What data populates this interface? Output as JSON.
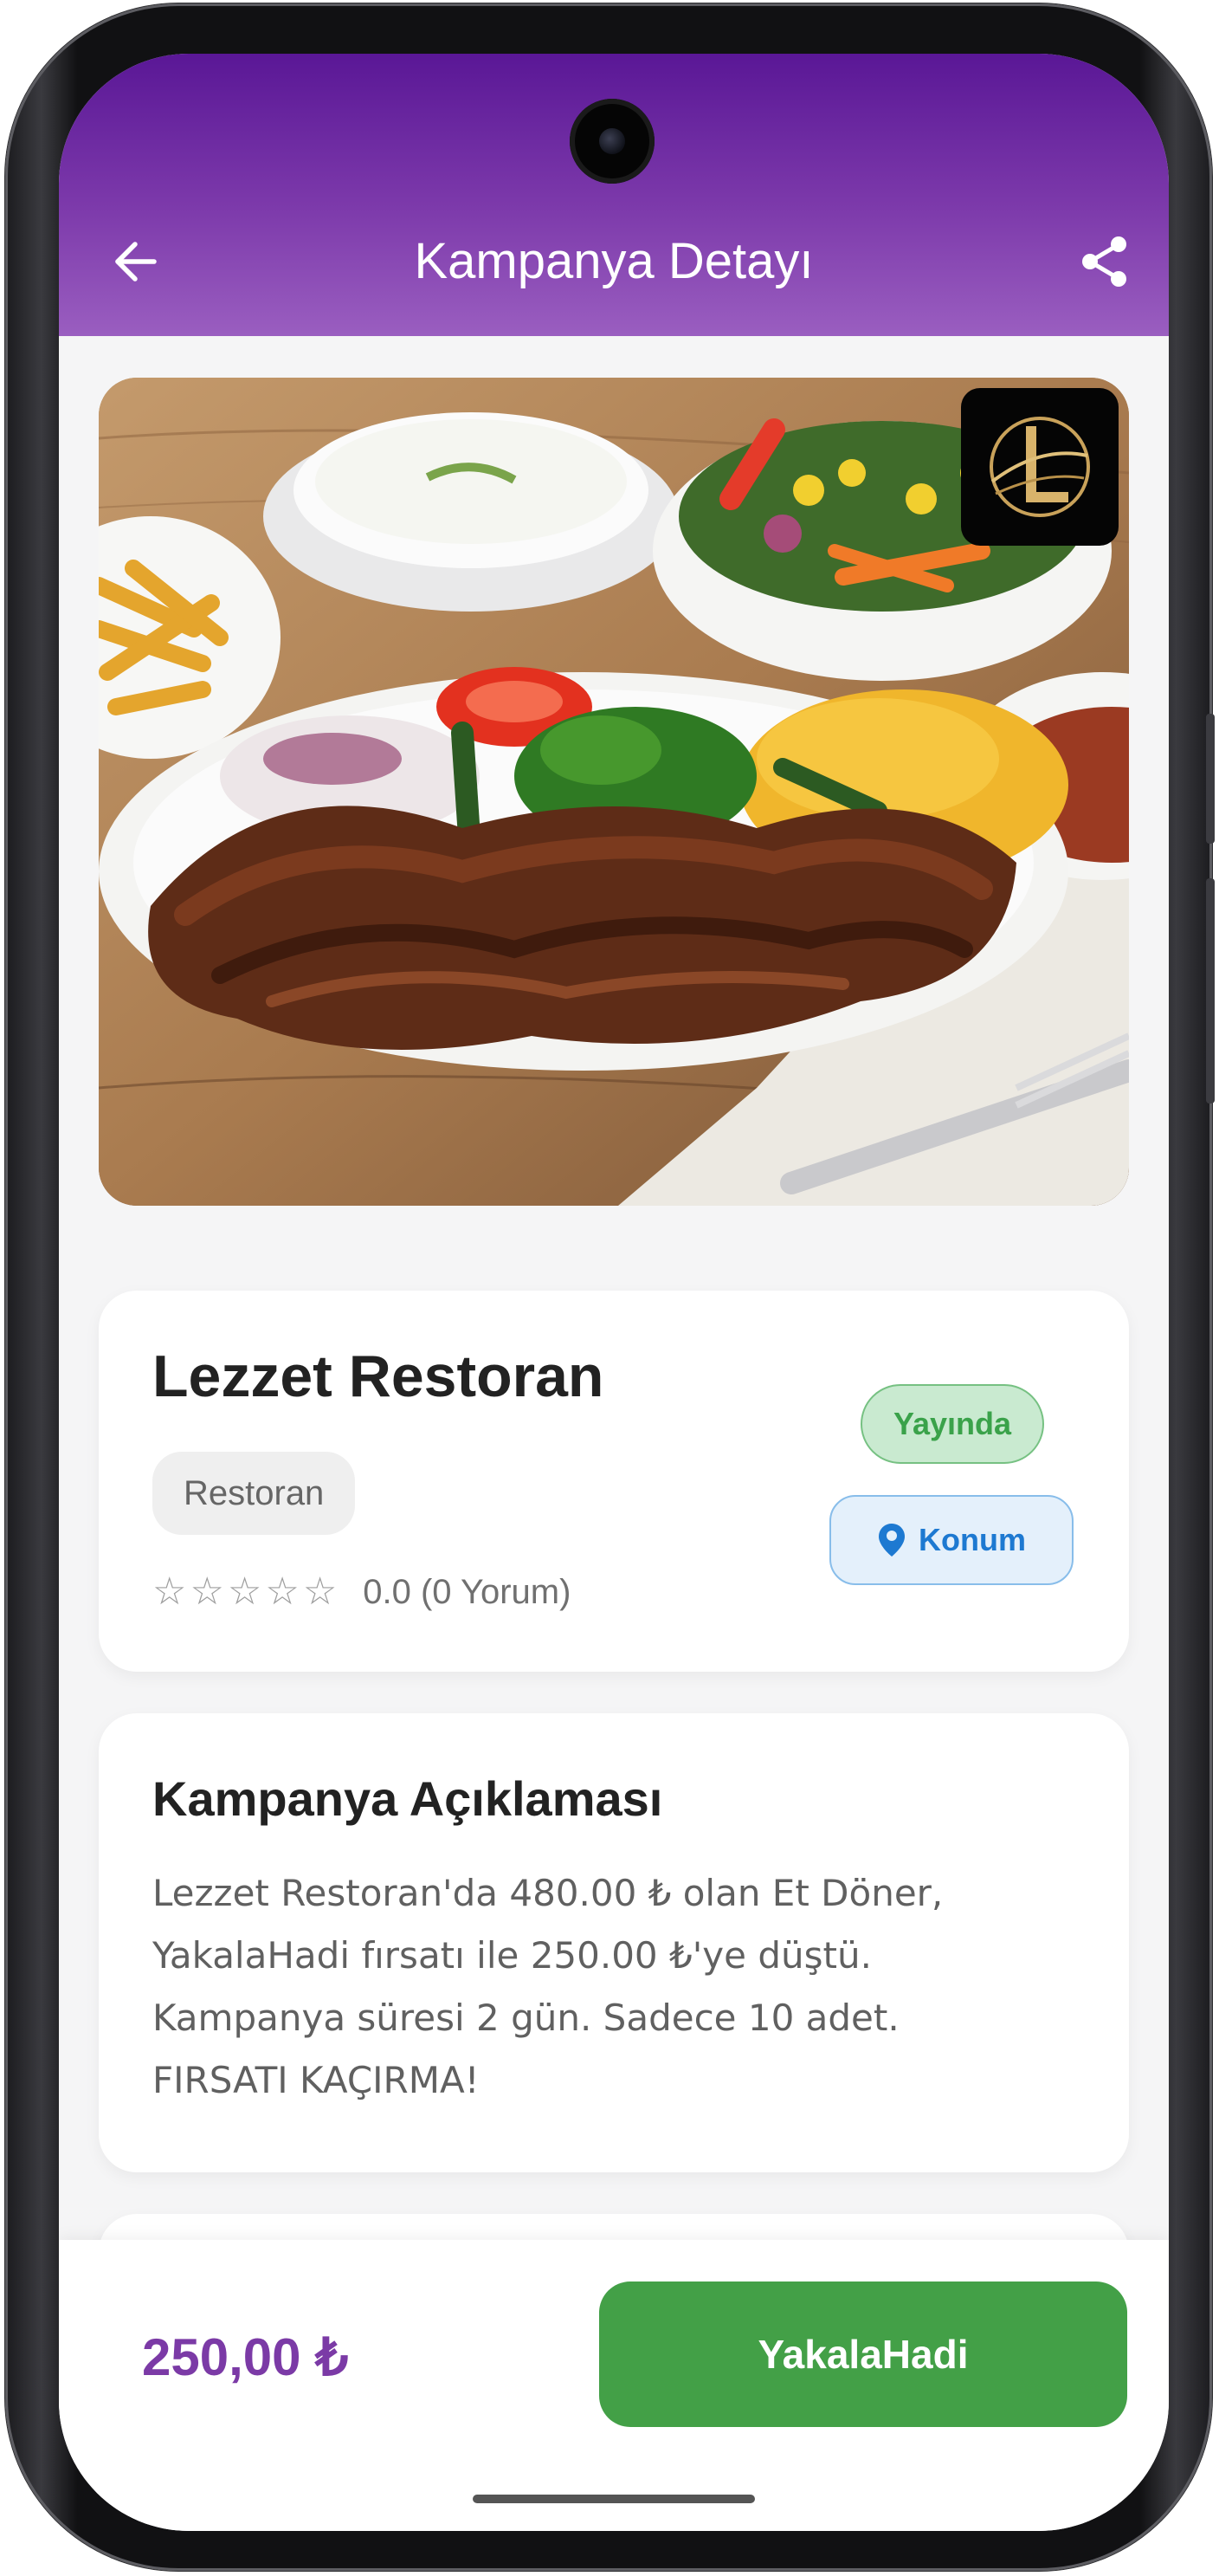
{
  "header": {
    "title": "Kampanya Detayı",
    "back_icon": "arrow-left-icon",
    "share_icon": "share-icon"
  },
  "hero": {
    "image_subject": "et döner plate with rice, salad, fries, yogurt",
    "logo_icon": "brand-logo-icon"
  },
  "restaurant": {
    "name": "Lezzet Restoran",
    "category": "Restoran",
    "stars": [
      "☆",
      "☆",
      "☆",
      "☆",
      "☆"
    ],
    "rating_text": "0.0 (0 Yorum)",
    "status": "Yayında",
    "location_label": "Konum",
    "location_icon": "location-pin-icon"
  },
  "description": {
    "title": "Kampanya Açıklaması",
    "lines": [
      "Lezzet Restoran'da 480.00 ₺ olan Et Döner,",
      "YakalaHadi fırsatı ile 250.00 ₺'ye düştü.",
      "Kampanya süresi 2 gün. Sadece 10 adet.",
      "FIRSATI KAÇIRMA!"
    ]
  },
  "bottom_bar": {
    "price": "250,00 ₺",
    "cta_label": "YakalaHadi"
  },
  "colors": {
    "header_gradient_top": "#5a1796",
    "header_gradient_bottom": "#9a5ec0",
    "price": "#7b3aa6",
    "cta": "#43a047",
    "status_bg": "#c9ead0",
    "status_text": "#3aa24a",
    "location_text": "#1d79d1"
  }
}
